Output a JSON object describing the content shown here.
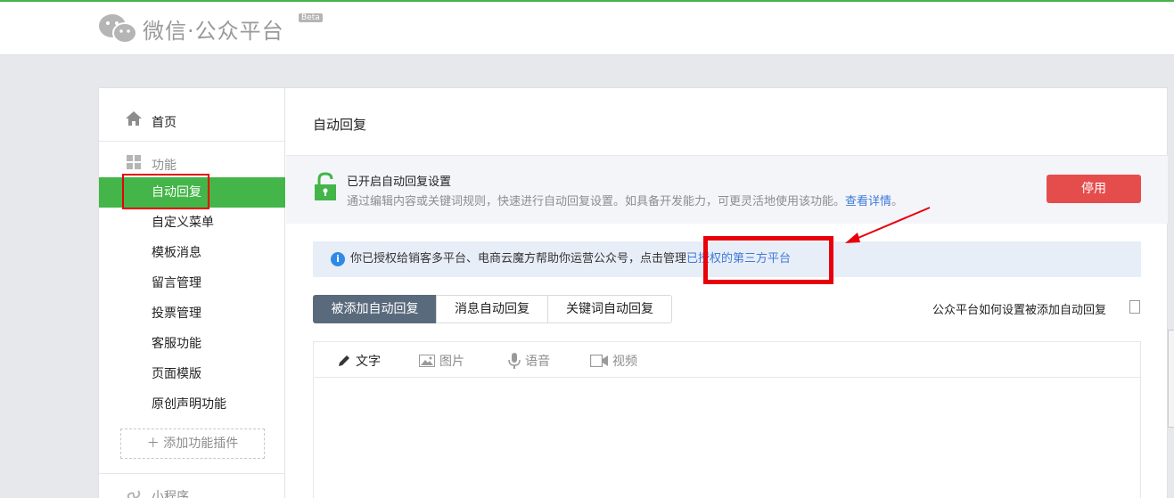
{
  "header": {
    "brand": "微信·公众平台",
    "badge": "Beta"
  },
  "sidebar": {
    "home": "首页",
    "section_title": "功能",
    "items": [
      {
        "label": "自动回复",
        "active": true
      },
      {
        "label": "自定义菜单"
      },
      {
        "label": "模板消息"
      },
      {
        "label": "留言管理"
      },
      {
        "label": "投票管理"
      },
      {
        "label": "客服功能"
      },
      {
        "label": "页面模版"
      },
      {
        "label": "原创声明功能"
      }
    ],
    "add_plugin": "添加功能插件",
    "mini_program": "小程序"
  },
  "main": {
    "title": "自动回复",
    "status": {
      "title": "已开启自动回复设置",
      "desc": "通过编辑内容或关键词规则，快速进行自动回复设置。如具备开发能力，可更灵活地使用该功能。",
      "link": "查看详情",
      "link_suffix": "。",
      "stop_button": "停用"
    },
    "notice": {
      "text": "你已授权给销客多平台、电商云魔方帮助你运营公众号，点击管理",
      "link": "已授权的第三方平台"
    },
    "tabs": [
      {
        "label": "被添加自动回复",
        "active": true
      },
      {
        "label": "消息自动回复"
      },
      {
        "label": "关键词自动回复"
      }
    ],
    "help_link": "公众平台如何设置被添加自动回复",
    "editor_tools": [
      {
        "label": "文字",
        "icon": "pencil-icon",
        "active": true
      },
      {
        "label": "图片",
        "icon": "image-icon"
      },
      {
        "label": "语音",
        "icon": "microphone-icon"
      },
      {
        "label": "视频",
        "icon": "video-icon"
      }
    ]
  },
  "colors": {
    "accent": "#44b549",
    "danger": "#e54d4d",
    "link": "#3e7ad9",
    "annotation": "#e8000b"
  }
}
